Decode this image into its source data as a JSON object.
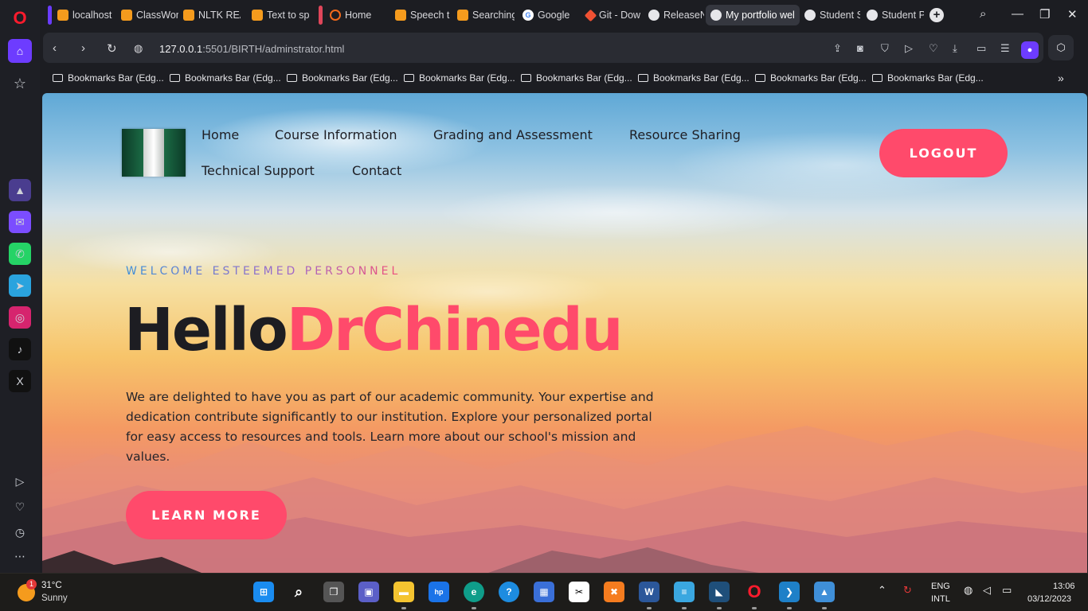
{
  "browser": {
    "tabs": [
      {
        "title": "localhost",
        "icon": "document-icon"
      },
      {
        "title": "ClassWor",
        "icon": "document-icon"
      },
      {
        "title": "NLTK REA",
        "icon": "document-icon"
      },
      {
        "title": "Text to sp",
        "icon": "document-icon"
      },
      {
        "title": "Home",
        "icon": "ring-icon"
      },
      {
        "title": "Speech t",
        "icon": "document-icon"
      },
      {
        "title": "Searching",
        "icon": "document-icon"
      },
      {
        "title": "Google",
        "icon": "google-icon"
      },
      {
        "title": "Git - Dow",
        "icon": "git-icon"
      },
      {
        "title": "ReleaseN",
        "icon": "globe-icon"
      },
      {
        "title": "My portfolio wel",
        "icon": "globe-icon"
      },
      {
        "title": "Student S",
        "icon": "globe-icon"
      },
      {
        "title": "Student P",
        "icon": "globe-icon"
      }
    ],
    "address": {
      "host": "127.0.0.1",
      "path": ":5501/BIRTH/adminstrator.html"
    },
    "bookmarks": [
      "Bookmarks Bar (Edg...",
      "Bookmarks Bar (Edg...",
      "Bookmarks Bar (Edg...",
      "Bookmarks Bar (Edg...",
      "Bookmarks Bar (Edg...",
      "Bookmarks Bar (Edg...",
      "Bookmarks Bar (Edg...",
      "Bookmarks Bar (Edg..."
    ]
  },
  "page": {
    "nav": {
      "home": "Home",
      "course": "Course Information",
      "grading": "Grading and Assessment",
      "resources": "Resource Sharing",
      "support": "Technical Support",
      "contact": "Contact"
    },
    "logout": "LOGOUT",
    "welcome": "WELCOME ESTEEMED PERSONNEL",
    "hello": "Hello",
    "name": "DrChinedu",
    "description": "We are delighted to have you as part of our academic community. Your expertise and dedication contribute significantly to our institution. Explore your personalized portal for easy access to resources and tools. Learn more about our school's mission and values.",
    "learn_more": "LEARN MORE",
    "accent_color": "#ff4a6b"
  },
  "taskbar": {
    "temperature": "31°C",
    "condition": "Sunny",
    "weather_badge": "1",
    "lang_line1": "ENG",
    "lang_line2": "INTL",
    "time": "13:06",
    "date": "03/12/2023"
  }
}
